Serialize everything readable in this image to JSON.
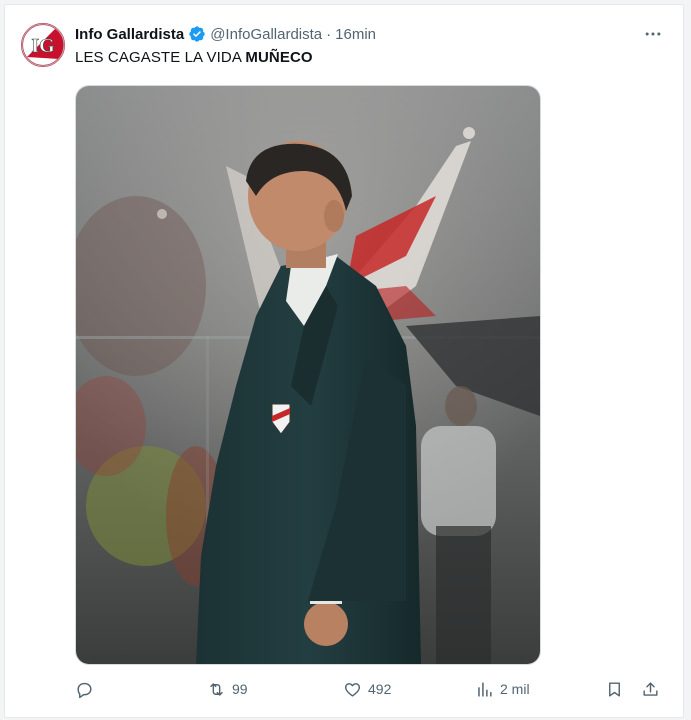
{
  "tweet": {
    "author_name": "Info Gallardista",
    "handle": "@InfoGallardista",
    "separator": "·",
    "time": "16min",
    "avatar_text": "IG",
    "text_regular": "LES CAGASTE LA VIDA ",
    "text_bold": "MUÑECO"
  },
  "actions": {
    "retweets": "99",
    "likes": "492",
    "views": "2 mil"
  },
  "colors": {
    "verified": "#1d9bf0",
    "avatar_red": "#c8102e",
    "muted_text": "#536471"
  },
  "icons": [
    "more-icon",
    "verified-icon",
    "reply-icon",
    "retweet-icon",
    "like-icon",
    "views-icon",
    "bookmark-icon",
    "share-icon"
  ]
}
